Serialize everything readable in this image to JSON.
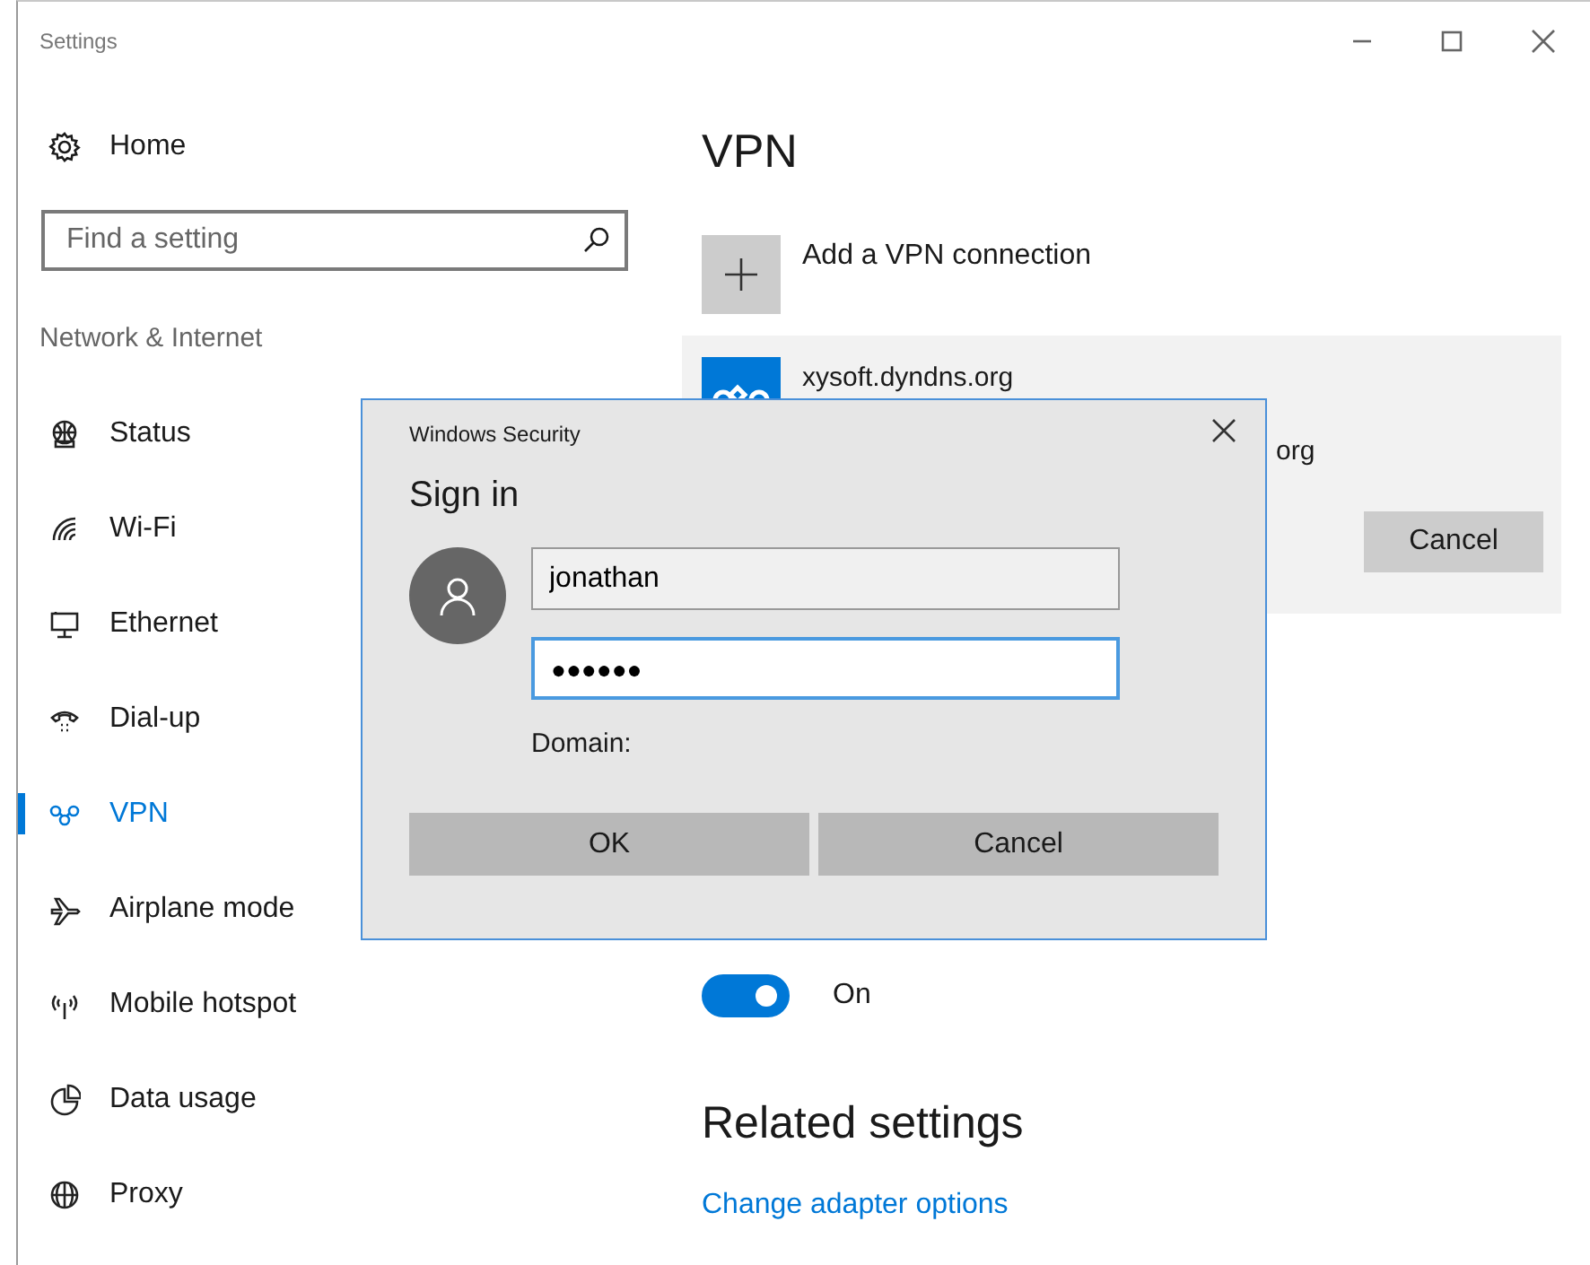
{
  "window": {
    "title": "Settings"
  },
  "sidebar": {
    "home": "Home",
    "search": {
      "placeholder": "Find a setting"
    },
    "section": "Network & Internet",
    "items": [
      {
        "label": "Status",
        "selected": false
      },
      {
        "label": "Wi-Fi",
        "selected": false
      },
      {
        "label": "Ethernet",
        "selected": false
      },
      {
        "label": "Dial-up",
        "selected": false
      },
      {
        "label": "VPN",
        "selected": true
      },
      {
        "label": "Airplane mode",
        "selected": false
      },
      {
        "label": "Mobile hotspot",
        "selected": false
      },
      {
        "label": "Data usage",
        "selected": false
      },
      {
        "label": "Proxy",
        "selected": false
      }
    ]
  },
  "main": {
    "title": "VPN",
    "add_label": "Add a VPN connection",
    "connection": {
      "name": "xysoft.dyndns.org",
      "detail": "org",
      "button": "Cancel"
    },
    "roaming_toggle": {
      "on": true,
      "label": "On"
    },
    "related": {
      "heading": "Related settings",
      "link": "Change adapter options"
    }
  },
  "dialog": {
    "title": "Windows Security",
    "heading": "Sign in",
    "username": {
      "value": "jonathan"
    },
    "password": {
      "value": "●●●●●●"
    },
    "domain_label": "Domain:",
    "buttons": [
      "OK",
      "Cancel"
    ]
  }
}
